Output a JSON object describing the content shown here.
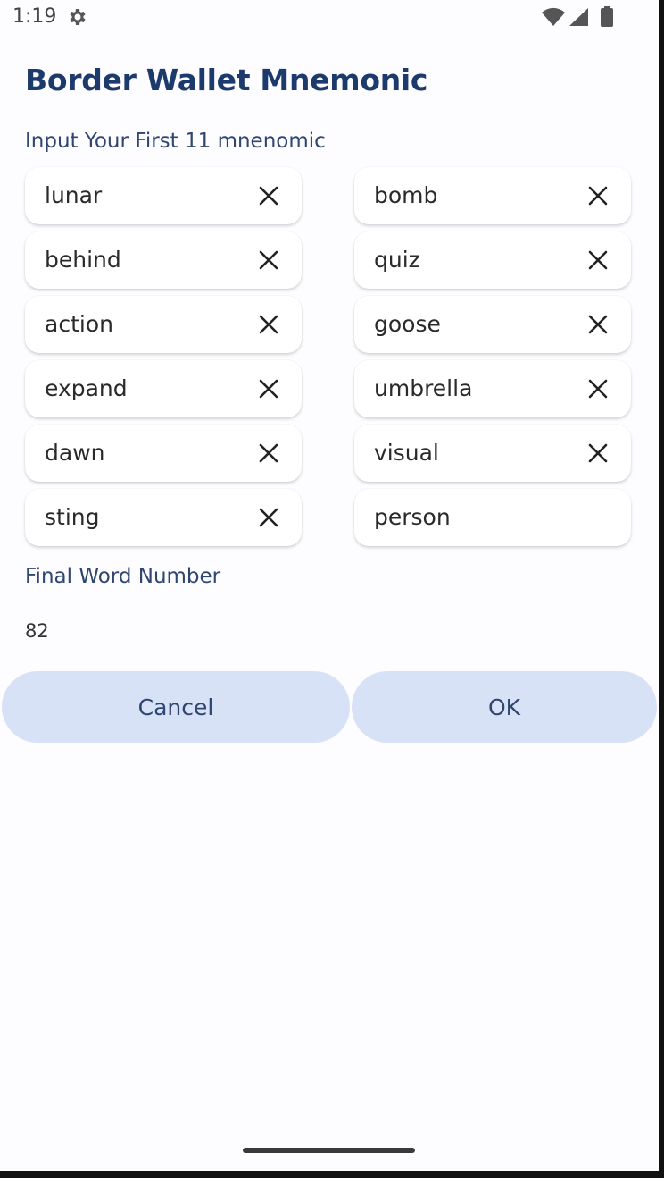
{
  "status_bar": {
    "time": "1:19"
  },
  "title": "Border Wallet Mnemonic",
  "input_label": "Input Your First 11 mnenomic",
  "words_left": [
    "lunar",
    "behind",
    "action",
    "expand",
    "dawn",
    "sting"
  ],
  "words_right": [
    "bomb",
    "quiz",
    "goose",
    "umbrella",
    "visual",
    "person"
  ],
  "final_word_label": "Final Word Number",
  "final_word_value": "82",
  "buttons": {
    "cancel": "Cancel",
    "ok": "OK"
  }
}
